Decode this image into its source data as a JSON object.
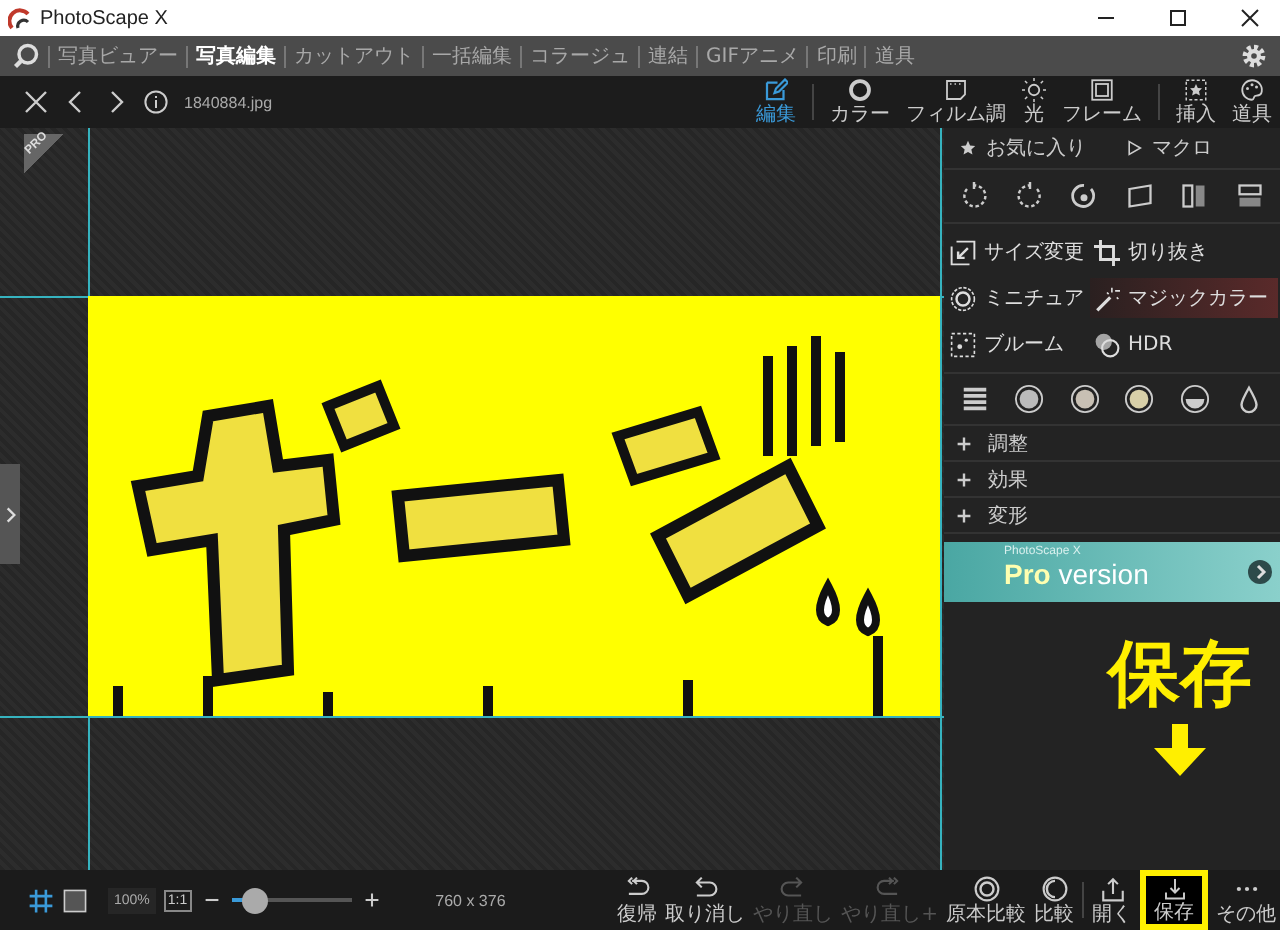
{
  "window": {
    "title": "PhotoScape X"
  },
  "menu": {
    "items": [
      {
        "label": "写真ビュアー",
        "selected": false
      },
      {
        "label": "写真編集",
        "selected": true
      },
      {
        "label": "カットアウト",
        "selected": false
      },
      {
        "label": "一括編集",
        "selected": false
      },
      {
        "label": "コラージュ",
        "selected": false
      },
      {
        "label": "連結",
        "selected": false
      },
      {
        "label": "GIFアニメ",
        "selected": false
      },
      {
        "label": "印刷",
        "selected": false
      },
      {
        "label": "道具",
        "selected": false
      }
    ]
  },
  "toolbar": {
    "file_name": "1840884.jpg",
    "tabs": [
      {
        "kind": "edit",
        "label": "編集",
        "selected": true
      },
      {
        "kind": "color",
        "label": "カラー",
        "selected": false
      },
      {
        "kind": "film",
        "label": "フィルム調",
        "selected": false
      },
      {
        "kind": "light",
        "label": "光",
        "selected": false
      },
      {
        "kind": "frame",
        "label": "フレーム",
        "selected": false
      },
      {
        "kind": "insert",
        "label": "挿入",
        "selected": false
      },
      {
        "kind": "tools",
        "label": "道具",
        "selected": false
      }
    ]
  },
  "canvas": {
    "badge": "PRO"
  },
  "panel": {
    "favorites": "お気に入り",
    "macro": "マクロ",
    "tools": [
      {
        "kind": "resize",
        "label": "サイズ変更",
        "selected": false
      },
      {
        "kind": "crop",
        "label": "切り抜き",
        "selected": false
      },
      {
        "kind": "miniature",
        "label": "ミニチュア",
        "selected": false
      },
      {
        "kind": "magic",
        "label": "マジックカラー",
        "selected": true
      },
      {
        "kind": "bloom",
        "label": "ブルーム",
        "selected": false
      },
      {
        "kind": "hdr",
        "label": "HDR",
        "selected": false
      }
    ],
    "sections": [
      {
        "label": "調整",
        "expanded": false
      },
      {
        "label": "効果",
        "expanded": false
      },
      {
        "label": "変形",
        "expanded": false
      }
    ],
    "banner": {
      "brand": "PhotoScape X",
      "pro": "Pro",
      "version": "version"
    }
  },
  "bottom_bar": {
    "grid_on": true,
    "zoom": "100%",
    "actual_size": "1:1",
    "slider": {
      "level": 0.2
    },
    "dimensions": "760 x 376",
    "actions": [
      {
        "kind": "revert",
        "label": "復帰",
        "disabled": false,
        "highlighted": false
      },
      {
        "kind": "undo",
        "label": "取り消し",
        "disabled": false,
        "highlighted": false
      },
      {
        "kind": "redo",
        "label": "やり直し",
        "disabled": true,
        "highlighted": false
      },
      {
        "kind": "redo-all",
        "label": "やり直し+",
        "disabled": true,
        "highlighted": false
      },
      {
        "kind": "compare-original",
        "label": "原本比較",
        "disabled": false,
        "highlighted": false
      },
      {
        "kind": "compare",
        "label": "比較",
        "disabled": false,
        "highlighted": false
      },
      {
        "kind": "open",
        "label": "開く",
        "disabled": false,
        "highlighted": false
      },
      {
        "kind": "save",
        "label": "保存",
        "disabled": false,
        "highlighted": true
      },
      {
        "kind": "more",
        "label": "その他",
        "disabled": false,
        "highlighted": false
      }
    ]
  },
  "annotation": {
    "text": "保存"
  }
}
